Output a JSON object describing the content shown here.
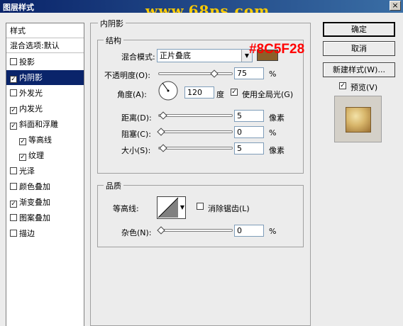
{
  "window": {
    "title": "图层样式",
    "close_glyph": "×",
    "watermark": "www.68ps.com"
  },
  "left_panel": {
    "header": "样式",
    "blend_default": "混合选项:默认",
    "items": [
      {
        "label": "投影",
        "checked": false,
        "selected": false,
        "indent": false
      },
      {
        "label": "内阴影",
        "checked": true,
        "selected": true,
        "indent": false
      },
      {
        "label": "外发光",
        "checked": false,
        "selected": false,
        "indent": false
      },
      {
        "label": "内发光",
        "checked": true,
        "selected": false,
        "indent": false
      },
      {
        "label": "斜面和浮雕",
        "checked": true,
        "selected": false,
        "indent": false
      },
      {
        "label": "等高线",
        "checked": true,
        "selected": false,
        "indent": true
      },
      {
        "label": "纹理",
        "checked": true,
        "selected": false,
        "indent": true
      },
      {
        "label": "光泽",
        "checked": false,
        "selected": false,
        "indent": false
      },
      {
        "label": "颜色叠加",
        "checked": false,
        "selected": false,
        "indent": false
      },
      {
        "label": "渐变叠加",
        "checked": true,
        "selected": false,
        "indent": false
      },
      {
        "label": "图案叠加",
        "checked": false,
        "selected": false,
        "indent": false
      },
      {
        "label": "描边",
        "checked": false,
        "selected": false,
        "indent": false
      }
    ],
    "check_glyph": "✓"
  },
  "inner_shadow": {
    "group_title": "内阴影",
    "structure": {
      "title": "结构",
      "blend_mode_label": "混合模式:",
      "blend_mode_value": "正片叠底",
      "color_hex_label": "#8C5F28",
      "color_swatch": "#8c5f28",
      "opacity_label": "不透明度(O):",
      "opacity_value": "75",
      "opacity_unit": "%",
      "opacity_level": 0.75,
      "angle_label": "角度(A):",
      "angle_value": "120",
      "angle_unit": "度",
      "global_light_label": "使用全局光(G)",
      "global_light_checked": true,
      "distance_label": "距离(D):",
      "distance_value": "5",
      "distance_unit": "像素",
      "choke_label": "阻塞(C):",
      "choke_value": "0",
      "choke_unit": "%",
      "size_label": "大小(S):",
      "size_value": "5",
      "size_unit": "像素"
    },
    "quality": {
      "title": "品质",
      "contour_label": "等高线:",
      "antialias_label": "消除锯齿(L)",
      "antialias_checked": false,
      "noise_label": "杂色(N):",
      "noise_value": "0",
      "noise_unit": "%"
    }
  },
  "actions": {
    "ok": "确定",
    "cancel": "取消",
    "new_style": "新建样式(W)...",
    "preview_label": "预览(V)",
    "preview_checked": true
  }
}
